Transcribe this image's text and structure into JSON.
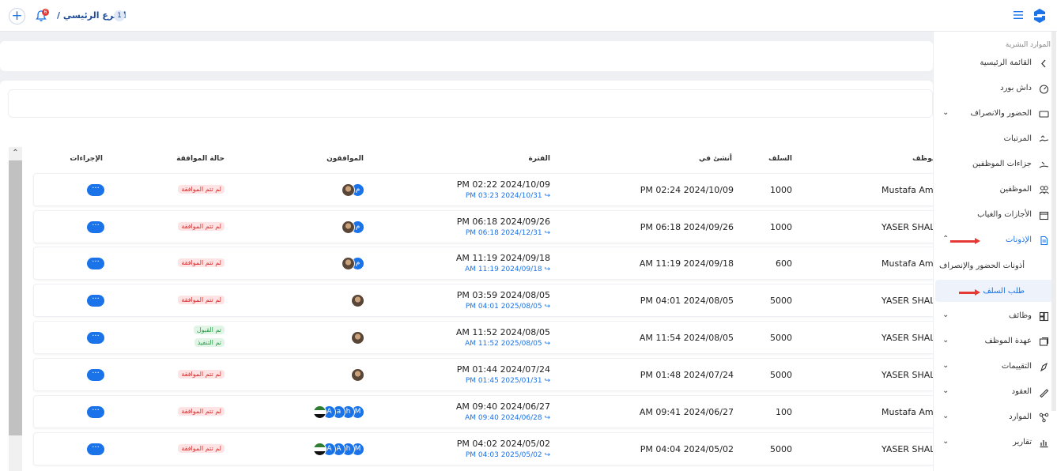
{
  "topbar": {
    "branch_label": "الفرع الرئيسي /",
    "branch_number": "1",
    "notification_count": "6",
    "add_symbol": "+"
  },
  "sidebar": {
    "section_title": "الموارد البشرية",
    "items": [
      {
        "label": "القائمة الرئيسية",
        "icon": "chevron-left-icon"
      },
      {
        "label": "داش بورد",
        "icon": "dashboard-icon"
      },
      {
        "label": "الحضور والانصراف",
        "icon": "ticket-icon",
        "expandable": true
      },
      {
        "label": "المرتبات",
        "icon": "salary-icon"
      },
      {
        "label": "جزاءات الموظفين",
        "icon": "penalty-icon"
      },
      {
        "label": "الموظفين",
        "icon": "users-icon"
      },
      {
        "label": "الأجازات والغياب",
        "icon": "calendar-icon"
      },
      {
        "label": "الإذونات",
        "icon": "document-icon",
        "expandable": true,
        "active": true
      },
      {
        "label": "وظائف",
        "icon": "jobs-icon",
        "expandable": true
      },
      {
        "label": "عهدة الموظف",
        "icon": "custody-icon",
        "expandable": true
      },
      {
        "label": "التقييمات",
        "icon": "rating-icon",
        "expandable": true
      },
      {
        "label": "العقود",
        "icon": "contract-icon",
        "expandable": true
      },
      {
        "label": "الموارد",
        "icon": "resources-icon",
        "expandable": true
      },
      {
        "label": "تقارير",
        "icon": "reports-icon",
        "expandable": true
      }
    ],
    "sub_items": [
      {
        "label": "أذونات الحضور والإنصراف"
      },
      {
        "label": "طلب السلف",
        "active": true
      }
    ]
  },
  "table": {
    "headers": {
      "employee": "موظف",
      "amount": "السلف",
      "created": "أنشئ في",
      "period": "الفترة",
      "approvers": "الموافقون",
      "status": "حالة الموافقة",
      "actions": "الإجراءات"
    },
    "action_label": "···",
    "rows": [
      {
        "employee": "Mustafa Am",
        "amount": "1000",
        "created": "PM 02:24 2024/10/09",
        "period_start": "PM 02:22 2024/10/09",
        "period_end": "PM 03:23 2024/10/31 ↪",
        "statuses": [
          "لم تتم الموافقة"
        ],
        "approvers": [
          "photo",
          "م"
        ]
      },
      {
        "employee": "YASER SHALA",
        "amount": "1000",
        "created": "PM 06:18 2024/09/26",
        "period_start": "PM 06:18 2024/09/26",
        "period_end": "PM 06:18 2024/12/31 ↪",
        "statuses": [
          "لم تتم الموافقة"
        ],
        "approvers": [
          "photo",
          "م"
        ]
      },
      {
        "employee": "Mustafa Am",
        "amount": "600",
        "created": "AM 11:19 2024/09/18",
        "period_start": "AM 11:19 2024/09/18",
        "period_end": "AM 11:19 2024/09/18 ↪",
        "statuses": [
          "لم تتم الموافقة"
        ],
        "approvers": [
          "photo",
          "م"
        ]
      },
      {
        "employee": "YASER SHALA",
        "amount": "5000",
        "created": "PM 04:01 2024/08/05",
        "period_start": "PM 03:59 2024/08/05",
        "period_end": "PM 04:01 2025/08/05 ↪",
        "statuses": [
          "لم تتم الموافقة"
        ],
        "approvers": [
          "photo"
        ]
      },
      {
        "employee": "YASER SHALA",
        "amount": "5000",
        "created": "AM 11:54 2024/08/05",
        "period_start": "AM 11:52 2024/08/05",
        "period_end": "AM 11:52 2025/08/05 ↪",
        "statuses": [
          "تم القبول",
          "تم التنفيذ"
        ],
        "approvers": [
          "photo"
        ]
      },
      {
        "employee": "YASER SHALA",
        "amount": "5000",
        "created": "PM 01:48 2024/07/24",
        "period_start": "PM 01:44 2024/07/24",
        "period_end": "PM 01:45 2025/01/31 ↪",
        "statuses": [
          "لم تتم الموافقة"
        ],
        "approvers": [
          "photo"
        ]
      },
      {
        "employee": "Mustafa Am",
        "amount": "100",
        "created": "AM 09:41 2024/06/27",
        "period_start": "AM 09:40 2024/06/27",
        "period_end": "AM 09:40 2024/06/28 ↪",
        "statuses": [
          "لم تتم الموافقة"
        ],
        "approvers": [
          "flag",
          "A",
          "a",
          "h",
          "M"
        ]
      },
      {
        "employee": "YASER SHALA",
        "amount": "5000",
        "created": "PM 04:04 2024/05/02",
        "period_start": "PM 04:02 2024/05/02",
        "period_end": "PM 04:03 2025/05/02 ↪",
        "statuses": [
          "لم تتم الموافقة"
        ],
        "approvers": [
          "flag",
          "A",
          "A",
          "h",
          "M"
        ]
      }
    ]
  },
  "colors": {
    "primary": "#1a73e8",
    "danger": "#d32f2f",
    "success": "#2e9a4a",
    "annotation_arrow": "#e53935"
  }
}
